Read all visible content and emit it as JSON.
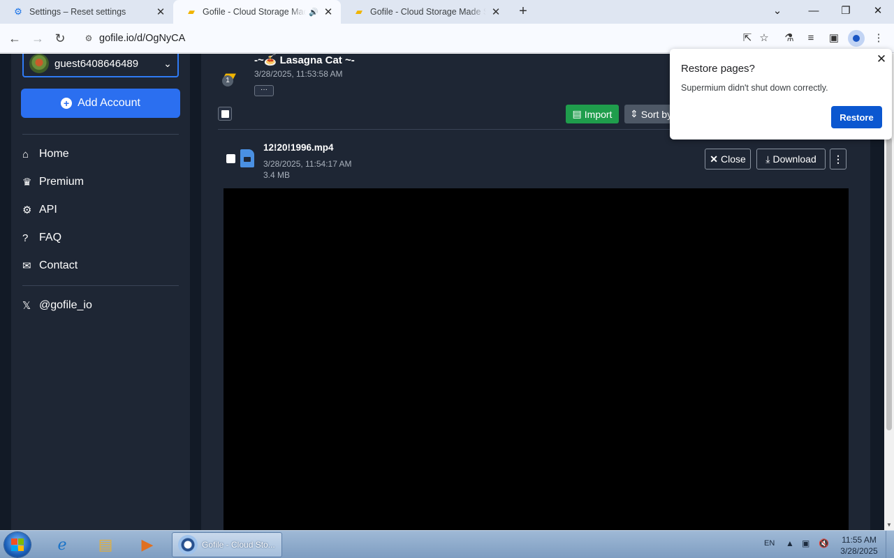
{
  "browser": {
    "tabs": [
      {
        "title": "Settings – Reset settings",
        "icon": "gear-icon",
        "active": false
      },
      {
        "title": "Gofile - Cloud Storage Made Simple",
        "icon": "gofile-favicon",
        "active": true,
        "audio": true
      },
      {
        "title": "Gofile - Cloud Storage Made Simple",
        "icon": "gofile-favicon",
        "active": false
      }
    ],
    "url": "gofile.io/d/OgNyCA"
  },
  "sidebar": {
    "account_name": "guest6408646489",
    "add_account_label": "Add Account",
    "nav": [
      {
        "label": "Home",
        "icon": "home-icon"
      },
      {
        "label": "Premium",
        "icon": "crown-icon"
      },
      {
        "label": "API",
        "icon": "gears-icon"
      },
      {
        "label": "FAQ",
        "icon": "question-icon"
      },
      {
        "label": "Contact",
        "icon": "envelope-icon"
      }
    ],
    "social_label": "@gofile_io"
  },
  "folder": {
    "name": "-~🍝 Lasagna Cat ~-",
    "date": "3/28/2025, 11:53:58 AM",
    "item_count": "1",
    "more_label": "···",
    "import_label": "Import",
    "sort_label": "Sort by"
  },
  "file": {
    "name": "12!20!1996.mp4",
    "date": "3/28/2025, 11:54:17 AM",
    "size": "3.4 MB",
    "close_label": "Close",
    "download_label": "Download"
  },
  "popup": {
    "title": "Restore pages?",
    "body": "Supermium didn't shut down correctly.",
    "restore_label": "Restore"
  },
  "taskbar": {
    "task_label": "Gofile - Cloud Sto...",
    "lang": "EN",
    "time": "11:55 AM",
    "date": "3/28/2025"
  },
  "colors": {
    "accent_blue": "#2b6ff0",
    "import_green": "#1f9d4c",
    "page_bg": "#121a26",
    "panel_bg": "#1e2634",
    "restore_blue": "#0b57d0"
  }
}
